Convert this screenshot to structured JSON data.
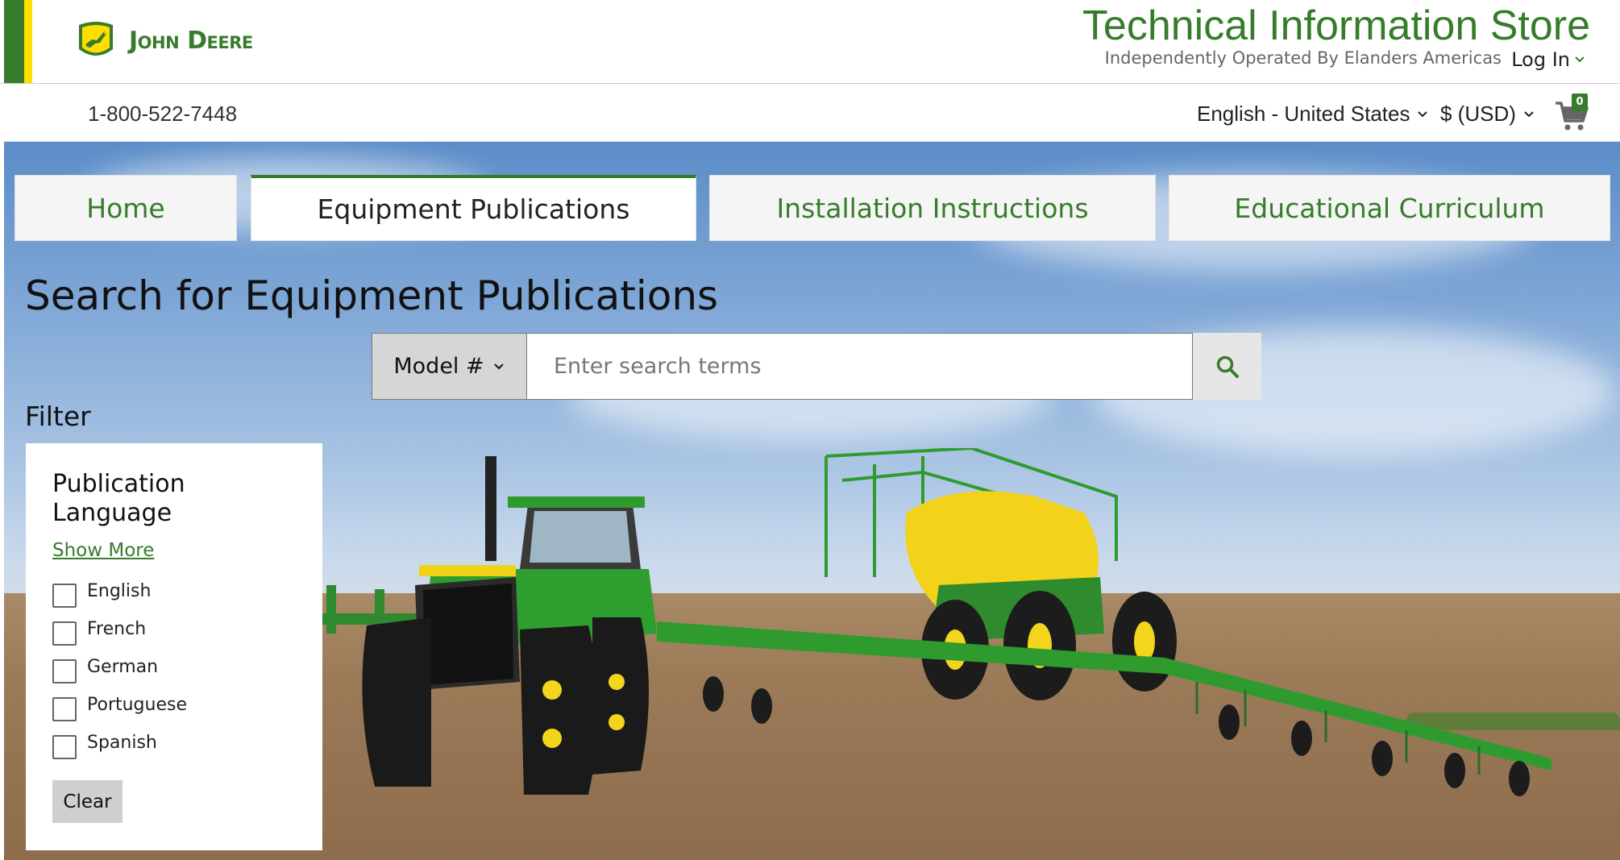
{
  "brand": {
    "name": "John Deere",
    "store_title": "Technical Information Store",
    "operated_by": "Independently Operated By Elanders Americas",
    "login_label": "Log In",
    "colors": {
      "green": "#367c2b",
      "yellow": "#ffde00"
    }
  },
  "utility_bar": {
    "phone": "1-800-522-7448",
    "language": "English - United States",
    "currency": "$ (USD)",
    "cart_count": "0"
  },
  "tabs": [
    {
      "label": "Home",
      "active": false
    },
    {
      "label": "Equipment Publications",
      "active": true
    },
    {
      "label": "Installation Instructions",
      "active": false
    },
    {
      "label": "Educational Curriculum",
      "active": false
    }
  ],
  "search": {
    "heading": "Search for Equipment Publications",
    "type_label": "Model #",
    "placeholder": "Enter search terms",
    "value": ""
  },
  "filter": {
    "heading": "Filter",
    "group_title": "Publication Language",
    "show_more": "Show More",
    "languages": [
      "English",
      "French",
      "German",
      "Portuguese",
      "Spanish"
    ],
    "clear_label": "Clear"
  }
}
